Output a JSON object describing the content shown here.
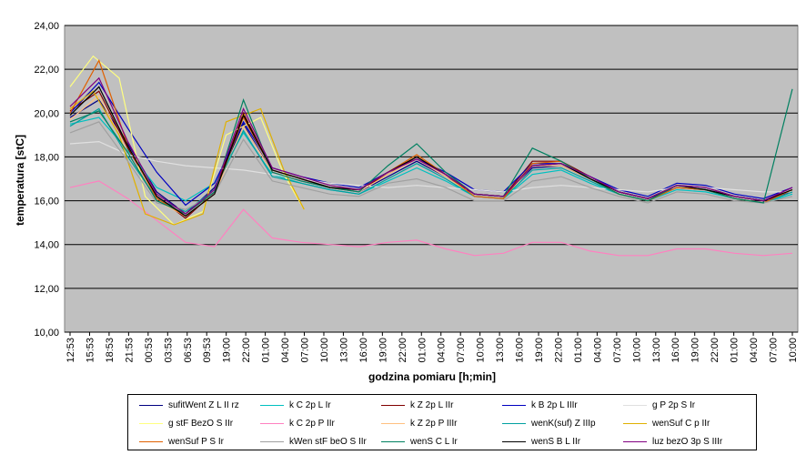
{
  "chart_data": {
    "type": "line",
    "title": "",
    "ylabel": "temperatura  [stC]",
    "xlabel": "godzina pomiaru [h;min]",
    "ylim": [
      10,
      24
    ],
    "yticks": [
      "10,00",
      "12,00",
      "14,00",
      "16,00",
      "18,00",
      "20,00",
      "22,00",
      "24,00"
    ],
    "x_ticks": [
      "12:53",
      "15:53",
      "18:53",
      "21:53",
      "00:53",
      "03:53",
      "06:53",
      "09:53",
      "19:00",
      "22:00",
      "01:00",
      "04:00",
      "07:00",
      "10:00",
      "13:00",
      "16:00",
      "19:00",
      "22:00",
      "01:00",
      "04:00",
      "07:00",
      "10:00",
      "13:00",
      "16:00",
      "19:00",
      "22:00",
      "01:00",
      "04:00",
      "07:00",
      "10:00",
      "13:00",
      "16:00",
      "19:00",
      "22:00",
      "01:00",
      "04:00",
      "07:00",
      "10:00"
    ],
    "grid": true,
    "legend_position": "bottom",
    "series": [
      {
        "name": "sufitWent Z L II rz",
        "color": "#000080",
        "values": [
          19.8,
          20.6,
          18.6,
          16.4,
          15.4,
          16.6,
          19.5,
          17.3,
          16.9,
          16.6,
          16.4,
          17.1,
          17.8,
          17.1,
          16.3,
          16.2,
          17.5,
          17.6,
          17.0,
          16.4,
          16.1,
          16.6,
          16.5,
          16.2,
          16.0,
          16.4
        ],
        "x": [
          0,
          1,
          2,
          3,
          4,
          5,
          6,
          7,
          8,
          9,
          10,
          11,
          12,
          13,
          14,
          15,
          16,
          17,
          18,
          19,
          20,
          21,
          22,
          23,
          24,
          25
        ]
      },
      {
        "name": "k C 2p L Ir",
        "color": "#00c0c0",
        "values": [
          19.5,
          19.8,
          18.3,
          16.6,
          16.0,
          16.8,
          19.1,
          17.2,
          16.8,
          16.5,
          16.3,
          16.9,
          17.5,
          16.9,
          16.2,
          16.1,
          17.2,
          17.4,
          16.8,
          16.3,
          16.0,
          16.5,
          16.4,
          16.1,
          15.9,
          16.3
        ],
        "x": [
          0,
          1,
          2,
          3,
          4,
          5,
          6,
          7,
          8,
          9,
          10,
          11,
          12,
          13,
          14,
          15,
          16,
          17,
          18,
          19,
          20,
          21,
          22,
          23,
          24,
          25
        ]
      },
      {
        "name": "k Z 2p L IIr",
        "color": "#800000",
        "values": [
          20.1,
          21.0,
          18.4,
          16.2,
          15.2,
          16.4,
          20.0,
          17.4,
          17.0,
          16.6,
          16.5,
          17.2,
          18.0,
          17.2,
          16.3,
          16.2,
          17.8,
          17.8,
          17.1,
          16.4,
          16.1,
          16.7,
          16.6,
          16.2,
          16.0,
          16.5
        ],
        "x": [
          0,
          1,
          2,
          3,
          4,
          5,
          6,
          7,
          8,
          9,
          10,
          11,
          12,
          13,
          14,
          15,
          16,
          17,
          18,
          19,
          20,
          21,
          22,
          23,
          24,
          25
        ]
      },
      {
        "name": "k B 2p L IIIr",
        "color": "#0000c0",
        "values": [
          20.0,
          21.4,
          19.3,
          17.3,
          15.8,
          16.8,
          19.6,
          17.5,
          17.1,
          16.8,
          16.6,
          17.3,
          17.9,
          17.3,
          16.5,
          16.4,
          17.7,
          17.7,
          17.1,
          16.5,
          16.2,
          16.8,
          16.7,
          16.3,
          16.1,
          16.6
        ],
        "x": [
          0,
          1,
          2,
          3,
          4,
          5,
          6,
          7,
          8,
          9,
          10,
          11,
          12,
          13,
          14,
          15,
          16,
          17,
          18,
          19,
          20,
          21,
          22,
          23,
          24,
          25
        ]
      },
      {
        "name": "g P 2p S Ir",
        "color": "#e0e0e0",
        "values": [
          18.6,
          18.7,
          18.1,
          17.8,
          17.6,
          17.5,
          17.4,
          17.2,
          17.0,
          16.8,
          16.7,
          16.6,
          16.7,
          16.6,
          16.5,
          16.4,
          16.6,
          16.7,
          16.6,
          16.5,
          16.4,
          16.6,
          16.6,
          16.5,
          16.4,
          16.4
        ],
        "x": [
          0,
          1,
          2,
          3,
          4,
          5,
          6,
          7,
          8,
          9,
          10,
          11,
          12,
          13,
          14,
          15,
          16,
          17,
          18,
          19,
          20,
          21,
          22,
          23,
          24,
          25
        ]
      },
      {
        "name": "g stF BezO S IIr",
        "color": "#ffff80",
        "values": [
          21.2,
          22.6,
          21.6,
          16.2,
          14.9,
          15.5,
          19.0,
          19.8,
          17.2,
          15.6
        ],
        "x": [
          0,
          0.8,
          1.7,
          2.6,
          3.6,
          4.6,
          5.4,
          6.6,
          7.4,
          8.1
        ]
      },
      {
        "name": "k C 2p P IIr",
        "color": "#ff80c0",
        "values": [
          16.6,
          16.9,
          16.1,
          15.1,
          14.1,
          13.9,
          15.6,
          14.3,
          14.1,
          14.0,
          13.9,
          14.1,
          14.2,
          13.8,
          13.5,
          13.6,
          14.1,
          14.1,
          13.7,
          13.5,
          13.5,
          13.8,
          13.8,
          13.6,
          13.5,
          13.6
        ],
        "x": [
          0,
          1,
          2,
          3,
          4,
          5,
          6,
          7,
          8,
          9,
          10,
          11,
          12,
          13,
          14,
          15,
          16,
          17,
          18,
          19,
          20,
          21,
          22,
          23,
          24,
          25
        ]
      },
      {
        "name": "k Z 2p  P IIIr",
        "color": "#ffc080",
        "values": [
          19.7,
          20.8,
          18.2,
          16.0,
          15.3,
          16.3,
          19.4,
          17.3,
          16.9,
          16.6,
          16.4,
          17.2,
          17.9,
          17.1,
          16.2,
          16.1,
          17.6,
          17.6,
          17.0,
          16.3,
          16.0,
          16.6,
          16.5,
          16.1,
          15.9,
          16.4
        ],
        "x": [
          0,
          1,
          2,
          3,
          4,
          5,
          6,
          7,
          8,
          9,
          10,
          11,
          12,
          13,
          14,
          15,
          16,
          17,
          18,
          19,
          20,
          21,
          22,
          23,
          24,
          25
        ]
      },
      {
        "name": "wenK(suf) Z  IIIp",
        "color": "#00a0a0",
        "values": [
          19.4,
          20.2,
          18.0,
          16.1,
          15.5,
          16.5,
          19.2,
          17.1,
          16.8,
          16.5,
          16.3,
          17.0,
          17.7,
          17.0,
          16.2,
          16.1,
          17.4,
          17.5,
          16.9,
          16.3,
          16.0,
          16.6,
          16.5,
          16.1,
          15.9,
          16.4
        ],
        "x": [
          0,
          1,
          2,
          3,
          4,
          5,
          6,
          7,
          8,
          9,
          10,
          11,
          12,
          13,
          14,
          15,
          16,
          17,
          18,
          19,
          20,
          21,
          22,
          23,
          24,
          25
        ]
      },
      {
        "name": "wenSuf C  p IIr",
        "color": "#e0b000",
        "values": [
          20.2,
          21.0,
          19.0,
          15.4,
          14.9,
          15.4,
          19.6,
          20.2,
          17.4,
          15.6
        ],
        "x": [
          0,
          0.8,
          1.7,
          2.6,
          3.6,
          4.6,
          5.4,
          6.6,
          7.4,
          8.1
        ]
      },
      {
        "name": "wenSuf P S Ir",
        "color": "#e06000",
        "values": [
          20.0,
          22.4,
          18.5,
          16.1,
          15.3,
          16.3,
          19.8,
          17.4,
          17.0,
          16.6,
          16.5,
          17.3,
          18.1,
          17.2,
          16.2,
          16.1,
          17.7,
          17.8,
          17.0,
          16.3,
          16.0,
          16.6,
          16.5,
          16.1,
          15.9,
          16.5
        ],
        "x": [
          0,
          1,
          2,
          3,
          4,
          5,
          6,
          7,
          8,
          9,
          10,
          11,
          12,
          13,
          14,
          15,
          16,
          17,
          18,
          19,
          20,
          21,
          22,
          23,
          24,
          25
        ]
      },
      {
        "name": "kWen stF beO S IIr",
        "color": "#a0a0a0",
        "values": [
          19.1,
          19.6,
          17.8,
          15.9,
          15.6,
          16.3,
          18.8,
          16.9,
          16.6,
          16.3,
          16.2,
          16.8,
          17.0,
          16.6,
          16.0,
          16.0,
          16.9,
          17.1,
          16.6,
          16.2,
          15.9,
          16.4,
          16.3,
          16.0,
          15.9,
          16.2
        ],
        "x": [
          0,
          1,
          2,
          3,
          4,
          5,
          6,
          7,
          8,
          9,
          10,
          11,
          12,
          13,
          14,
          15,
          16,
          17,
          18,
          19,
          20,
          21,
          22,
          23,
          24,
          25
        ]
      },
      {
        "name": "wenS C L Ir",
        "color": "#008060",
        "values": [
          19.6,
          20.1,
          18.2,
          16.0,
          15.4,
          16.4,
          20.6,
          17.3,
          16.9,
          16.6,
          16.4,
          17.6,
          18.6,
          17.3,
          16.3,
          16.2,
          18.4,
          17.8,
          17.0,
          16.3,
          16.0,
          16.7,
          16.5,
          16.1,
          15.9,
          21.1
        ],
        "x": [
          0,
          1,
          2,
          3,
          4,
          5,
          6,
          7,
          8,
          9,
          10,
          11,
          12,
          13,
          14,
          15,
          16,
          17,
          18,
          19,
          20,
          21,
          22,
          23,
          24,
          25
        ]
      },
      {
        "name": "wenS B L IIr",
        "color": "#000000",
        "values": [
          19.9,
          21.2,
          18.5,
          16.2,
          15.3,
          16.3,
          19.9,
          17.4,
          17.0,
          16.6,
          16.5,
          17.3,
          18.0,
          17.2,
          16.3,
          16.2,
          17.6,
          17.7,
          17.0,
          16.4,
          16.1,
          16.7,
          16.5,
          16.2,
          16.0,
          16.5
        ],
        "x": [
          0,
          1,
          2,
          3,
          4,
          5,
          6,
          7,
          8,
          9,
          10,
          11,
          12,
          13,
          14,
          15,
          16,
          17,
          18,
          19,
          20,
          21,
          22,
          23,
          24,
          25
        ]
      },
      {
        "name": "luz bezO 3p S IIIr",
        "color": "#800080",
        "values": [
          20.3,
          21.6,
          18.7,
          16.3,
          15.4,
          16.5,
          20.2,
          17.5,
          17.1,
          16.7,
          16.5,
          17.3,
          17.9,
          17.2,
          16.3,
          16.2,
          17.6,
          17.7,
          17.1,
          16.4,
          16.1,
          16.7,
          16.6,
          16.2,
          16.0,
          16.6
        ],
        "x": [
          0,
          1,
          2,
          3,
          4,
          5,
          6,
          7,
          8,
          9,
          10,
          11,
          12,
          13,
          14,
          15,
          16,
          17,
          18,
          19,
          20,
          21,
          22,
          23,
          24,
          25
        ]
      }
    ]
  }
}
